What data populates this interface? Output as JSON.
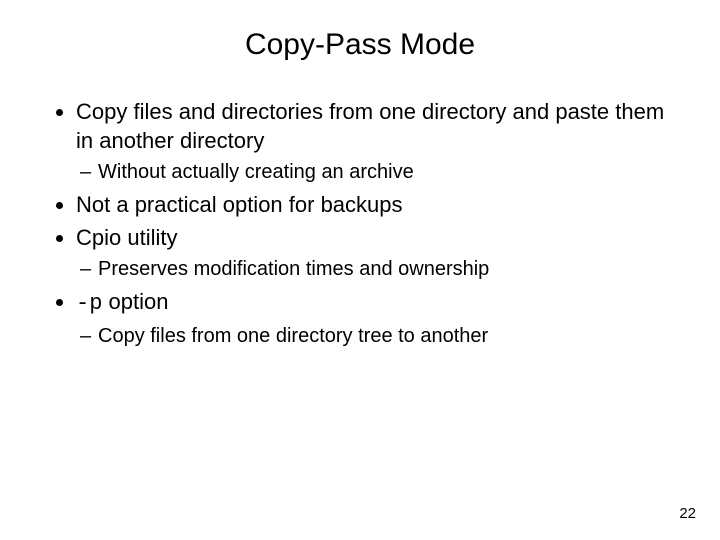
{
  "title": "Copy-Pass Mode",
  "bullets": [
    {
      "text": "Copy files and directories from one directory and paste them in another directory",
      "sub": [
        "Without actually creating an archive"
      ]
    },
    {
      "text": "Not a practical option for backups",
      "sub": []
    },
    {
      "text": "Cpio utility",
      "sub": [
        "Preserves modification times and ownership"
      ]
    },
    {
      "text_prefix": "-p",
      "text_suffix": " option",
      "mono_prefix": true,
      "sub": [
        "Copy files from one directory tree to another"
      ]
    }
  ],
  "page_number": "22"
}
